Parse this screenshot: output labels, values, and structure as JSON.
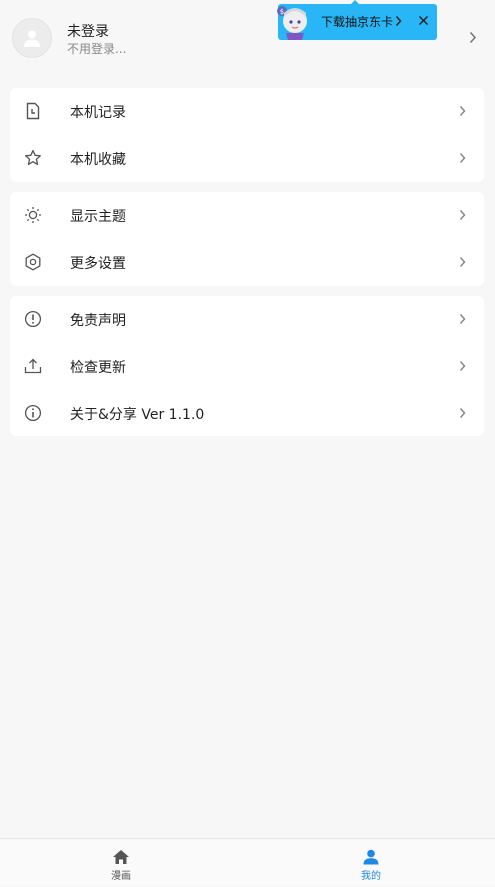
{
  "profile": {
    "name": "未登录",
    "subtitle": "不用登录..."
  },
  "ad": {
    "text": "下载抽京东卡",
    "color": "#29b6f6"
  },
  "groups": [
    {
      "items": [
        {
          "label": "本机记录",
          "icon": "document-icon"
        },
        {
          "label": "本机收藏",
          "icon": "star-icon"
        }
      ]
    },
    {
      "items": [
        {
          "label": "显示主题",
          "icon": "sun-icon"
        },
        {
          "label": "更多设置",
          "icon": "hexagon-settings-icon"
        }
      ]
    },
    {
      "items": [
        {
          "label": "免责声明",
          "icon": "exclamation-circle-icon"
        },
        {
          "label": "检查更新",
          "icon": "upload-icon"
        },
        {
          "label": "关于&分享 Ver 1.1.0",
          "icon": "info-circle-icon"
        }
      ]
    }
  ],
  "bottom_nav": {
    "tabs": [
      {
        "label": "漫画",
        "icon": "home-icon",
        "active": false
      },
      {
        "label": "我的",
        "icon": "person-icon",
        "active": true
      }
    ],
    "active_color": "#1e88e5",
    "inactive_color": "#555555"
  }
}
